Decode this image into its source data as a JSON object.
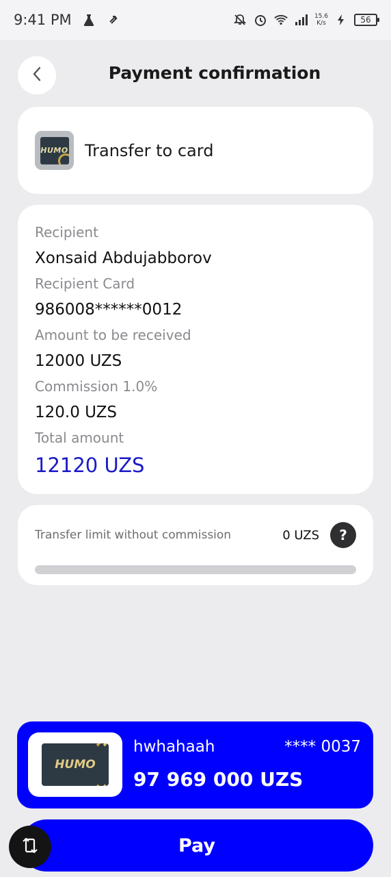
{
  "status_bar": {
    "time": "9:41 PM",
    "net_speed_value": "15.6",
    "net_speed_unit": "K/s",
    "battery": "56"
  },
  "header": {
    "title": "Payment confirmation"
  },
  "transfer": {
    "logo_text": "HUMO",
    "title": "Transfer to card"
  },
  "details": {
    "recipient_label": "Recipient",
    "recipient_value": "Xonsaid Abdujabborov",
    "card_label": "Recipient Card",
    "card_value": "986008******0012",
    "amount_label": "Amount to be received",
    "amount_value": "12000 UZS",
    "commission_label": "Commission 1.0%",
    "commission_value": "120.0 UZS",
    "total_label": "Total amount",
    "total_value": "12120 UZS"
  },
  "limit": {
    "label": "Transfer limit without commission",
    "value": "0 UZS",
    "help": "?",
    "progress": 0
  },
  "source_card": {
    "logo_text": "HUMO",
    "name": "hwhahaah",
    "number": "**** 0037",
    "balance": "97 969 000 UZS"
  },
  "pay_button": {
    "label": "Pay"
  },
  "colors": {
    "accent": "#0000ff",
    "total_text": "#1a1ac8",
    "background": "#ecebed"
  }
}
